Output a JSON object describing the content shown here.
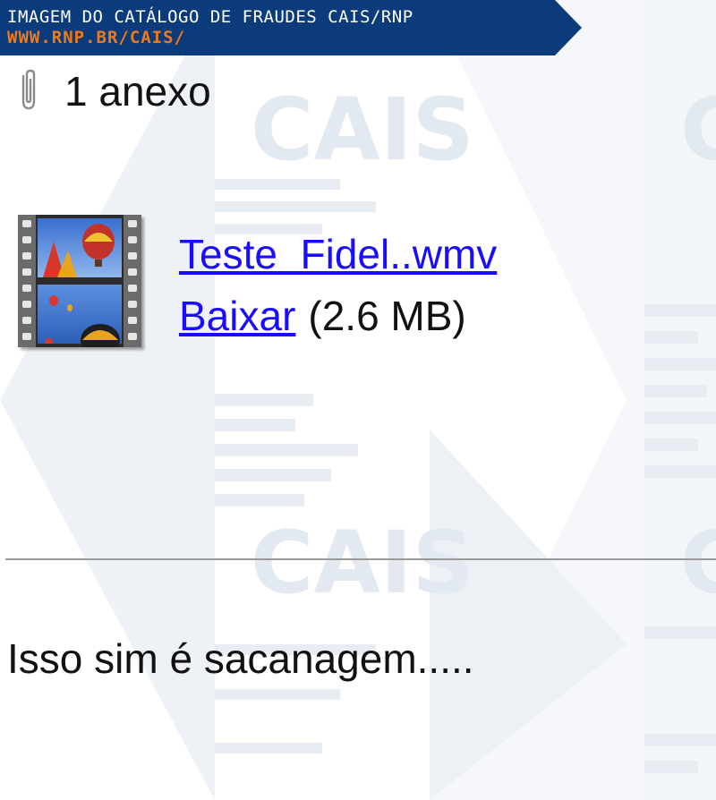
{
  "banner": {
    "line1": "IMAGEM DO CATÁLOGO DE FRAUDES CAIS/RNP",
    "line2": "WWW.RNP.BR/CAIS/",
    "color": "#0b3b7a",
    "accent": "#f07a1a"
  },
  "watermark": {
    "text": "CAIS",
    "color": "#e3e9f0"
  },
  "attachments": {
    "count_label": "1 anexo",
    "icon": "paperclip-icon",
    "items": [
      {
        "thumbnail": "video-film-thumbnail",
        "name": "Teste  Fidel..wmv",
        "download_label": "Baixar",
        "size": "(2.6 MB)"
      }
    ]
  },
  "message": {
    "text": "Isso sim é sacanagem....."
  },
  "colors": {
    "link": "#1a0dff",
    "text": "#111111",
    "divider": "#9a9a9a"
  }
}
